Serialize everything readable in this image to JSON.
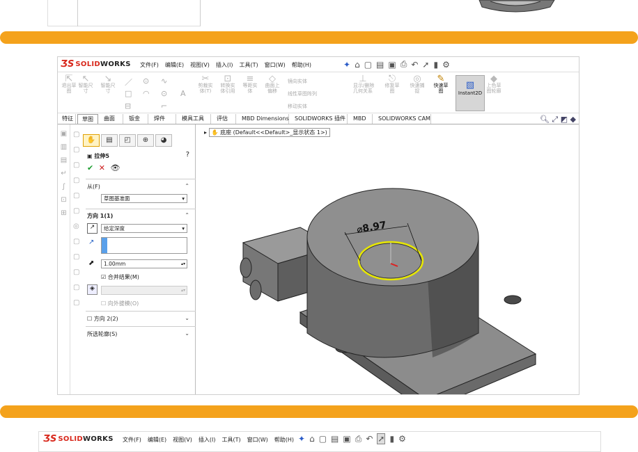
{
  "menu": {
    "items": [
      "文件(F)",
      "编辑(E)",
      "视图(V)",
      "插入(I)",
      "工具(T)",
      "窗口(W)",
      "帮助(H)"
    ]
  },
  "logo": {
    "prefix": "SOLID",
    "suffix": "WORKS"
  },
  "ribbon": {
    "buttons": [
      {
        "label": "退出草\n图"
      },
      {
        "label": "智能尺\n寸"
      },
      {
        "label": "智能尺\n寸"
      },
      {
        "label": "剪裁实\n体(T)"
      },
      {
        "label": "转换实\n体引用"
      },
      {
        "label": "等距实\n体"
      },
      {
        "label": "曲面上\n偏移"
      },
      {
        "label": "显示/删除\n几何关系"
      },
      {
        "label": "修复草\n图"
      },
      {
        "label": "快速捕\n捉"
      },
      {
        "label": "快速草\n图"
      },
      {
        "label": "Instant2D"
      },
      {
        "label": "上色草\n图轮廓"
      }
    ],
    "small": [
      "镜向实体",
      "线性草图阵列",
      "移动实体"
    ]
  },
  "tabs": [
    "特征",
    "草图",
    "曲面",
    "钣金",
    "焊件",
    "模具工具",
    "评估",
    "MBD Dimensions",
    "SOLIDWORKS 插件",
    "MBD",
    "SOLIDWORKS CAM"
  ],
  "tree": {
    "label": "底座  (Default<<Default>_显示状态 1>)"
  },
  "pm": {
    "title": "拉伸5",
    "from_label": "从(F)",
    "from_value": "草图基准面",
    "dir1_label": "方向 1(1)",
    "dir1_value": "给定深度",
    "depth": "1.00mm",
    "merge": "合并结果(M)",
    "draft": "向外拔模(O)",
    "dir2_label": "方向 2(2)",
    "contours_label": "所选轮廓(S)"
  },
  "dimension": {
    "value": "⌀8.97"
  },
  "bottom": {
    "menu": [
      "文件(F)",
      "编辑(E)",
      "视图(V)",
      "插入(I)",
      "工具(T)",
      "窗口(W)",
      "帮助(H)"
    ]
  }
}
